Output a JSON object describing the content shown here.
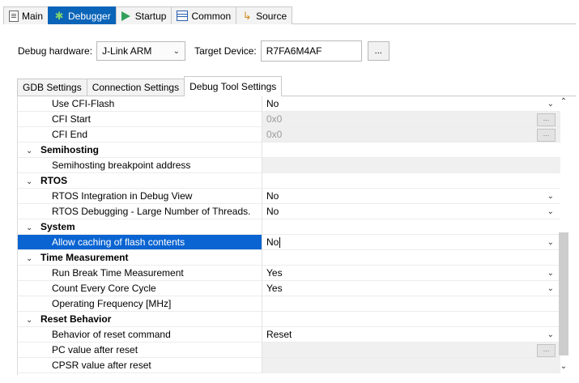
{
  "tabs": [
    {
      "label": "Main",
      "icon": "main-tab-icon",
      "active": false
    },
    {
      "label": "Debugger",
      "icon": "debugger-bug-icon",
      "active": true
    },
    {
      "label": "Startup",
      "icon": "startup-play-icon",
      "active": false
    },
    {
      "label": "Common",
      "icon": "common-window-icon",
      "active": false
    },
    {
      "label": "Source",
      "icon": "source-folder-icon",
      "active": false
    }
  ],
  "hardware": {
    "label": "Debug hardware:",
    "value": "J-Link ARM",
    "target_label": "Target Device:",
    "target_value": "R7FA6M4AF",
    "browse_label": "..."
  },
  "inner_tabs": [
    {
      "label": "GDB Settings",
      "active": false
    },
    {
      "label": "Connection Settings",
      "active": false
    },
    {
      "label": "Debug Tool Settings",
      "active": true
    }
  ],
  "rows": [
    {
      "kind": "item",
      "name": "Use CFI-Flash",
      "value": "No",
      "control": "dropdown"
    },
    {
      "kind": "item",
      "name": "CFI Start",
      "value": "0x0",
      "control": "button",
      "disabled": true
    },
    {
      "kind": "item",
      "name": "CFI End",
      "value": "0x0",
      "control": "button",
      "disabled": true
    },
    {
      "kind": "group",
      "name": "Semihosting"
    },
    {
      "kind": "item",
      "name": "Semihosting breakpoint address",
      "value": "",
      "control": "none",
      "empty": true
    },
    {
      "kind": "group",
      "name": "RTOS"
    },
    {
      "kind": "item",
      "name": "RTOS Integration in Debug View",
      "value": "No",
      "control": "dropdown"
    },
    {
      "kind": "item",
      "name": "RTOS Debugging - Large Number of Threads.",
      "value": "No",
      "control": "dropdown"
    },
    {
      "kind": "group",
      "name": "System"
    },
    {
      "kind": "item",
      "name": "Allow caching of flash contents",
      "value": "No",
      "control": "dropdown",
      "selected": true
    },
    {
      "kind": "group",
      "name": "Time Measurement"
    },
    {
      "kind": "item",
      "name": "Run Break Time Measurement",
      "value": "Yes",
      "control": "dropdown"
    },
    {
      "kind": "item",
      "name": "Count Every Core Cycle",
      "value": "Yes",
      "control": "dropdown"
    },
    {
      "kind": "item",
      "name": "Operating Frequency [MHz]",
      "value": "",
      "control": "none"
    },
    {
      "kind": "group",
      "name": "Reset Behavior"
    },
    {
      "kind": "item",
      "name": "Behavior of reset command",
      "value": "Reset",
      "control": "dropdown"
    },
    {
      "kind": "item",
      "name": "PC value after reset",
      "value": "",
      "control": "button",
      "empty": true
    },
    {
      "kind": "item",
      "name": "CPSR value after reset",
      "value": "",
      "control": "none",
      "empty": true
    }
  ],
  "glyphs": {
    "chevron_down": "⌄",
    "chevron_up": "⌃",
    "mini_button": "..."
  }
}
